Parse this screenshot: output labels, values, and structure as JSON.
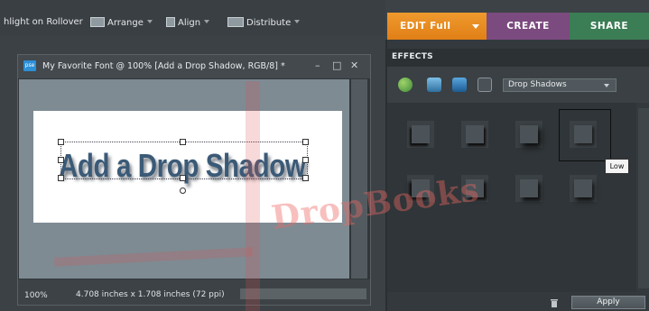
{
  "toolbar": {
    "highlight_label": "hlight on Rollover",
    "arrange_label": "Arrange",
    "align_label": "Align",
    "distribute_label": "Distribute"
  },
  "modes": {
    "edit_label": "EDIT Full",
    "create_label": "CREATE",
    "share_label": "SHARE",
    "edit_color": "#e8881f",
    "create_color": "#7b4a7f",
    "share_color": "#3b7d55"
  },
  "document": {
    "badge": "pse",
    "title": "My Favorite Font @ 100% [Add a Drop Shadow, RGB/8] *",
    "minimize_glyph": "–",
    "maximize_glyph": "□",
    "close_glyph": "✕",
    "canvas_text": "Add a Drop Shadow",
    "zoom": "100%",
    "image_size": "4.708 inches x 1.708 inches (72 ppi)"
  },
  "effects_panel": {
    "tab_label": "EFFECTS",
    "filter_icons": [
      "layer-styles-icon",
      "photo-effects-icon",
      "filters-icon",
      "fx-icon"
    ],
    "category_selected": "Drop Shadows",
    "thumbnails": [
      {
        "name": "drop-shadow-1"
      },
      {
        "name": "drop-shadow-2"
      },
      {
        "name": "drop-shadow-3"
      },
      {
        "name": "drop-shadow-low",
        "selected": true
      },
      {
        "name": "drop-shadow-5"
      },
      {
        "name": "drop-shadow-6"
      },
      {
        "name": "drop-shadow-7"
      },
      {
        "name": "drop-shadow-8"
      }
    ],
    "tooltip": "Low",
    "apply_label": "Apply"
  },
  "watermark": "DropBooks"
}
